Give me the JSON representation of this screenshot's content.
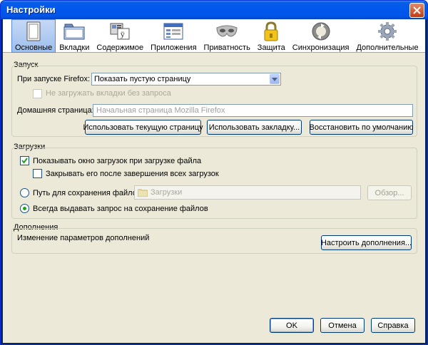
{
  "window": {
    "title": "Настройки"
  },
  "toolbar": {
    "tabs": [
      {
        "label": "Основные",
        "icon": "general-icon",
        "active": true
      },
      {
        "label": "Вкладки",
        "icon": "tabs-icon"
      },
      {
        "label": "Содержимое",
        "icon": "content-icon"
      },
      {
        "label": "Приложения",
        "icon": "applications-icon"
      },
      {
        "label": "Приватность",
        "icon": "privacy-mask-icon"
      },
      {
        "label": "Защита",
        "icon": "security-lock-icon"
      },
      {
        "label": "Синхронизация",
        "icon": "sync-icon"
      },
      {
        "label": "Дополнительные",
        "icon": "advanced-gear-icon"
      }
    ]
  },
  "startup": {
    "group_label": "Запуск",
    "on_start_label": "При запуске Firefox:",
    "on_start_value": "Показать пустую страницу",
    "no_load_tabs_label": "Не загружать вкладки без запроса",
    "no_load_tabs_checked": false,
    "homepage_label": "Домашняя страница:",
    "homepage_placeholder": "Начальная страница Mozilla Firefox",
    "use_current_label": "Использовать текущую страницу",
    "use_bookmark_label": "Использовать закладку...",
    "restore_default_label": "Восстановить по умолчанию"
  },
  "downloads": {
    "group_label": "Загрузки",
    "show_window_label": "Показывать окно загрузок при загрузке файла",
    "show_window_checked": true,
    "close_when_done_label": "Закрывать его после завершения всех загрузок",
    "close_when_done_checked": false,
    "save_path_label": "Путь для сохранения файлов",
    "save_path_value": "Загрузки",
    "browse_label": "Обзор...",
    "always_ask_label": "Всегда выдавать запрос на сохранение файлов",
    "selected_option": "always_ask"
  },
  "addons": {
    "group_label": "Дополнения",
    "description": "Изменение параметров дополнений",
    "manage_label": "Настроить дополнения..."
  },
  "footer": {
    "ok_label": "OK",
    "cancel_label": "Отмена",
    "help_label": "Справка"
  }
}
